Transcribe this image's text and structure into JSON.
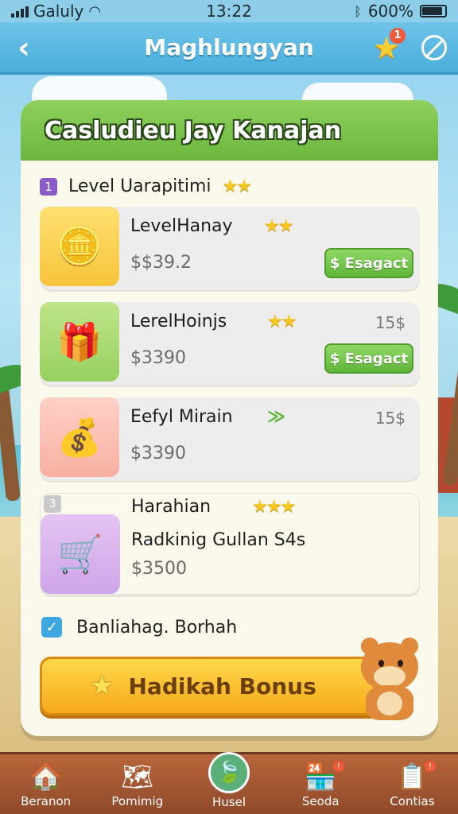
{
  "status_bar": {
    "carrier": "Galuly",
    "time": "13:22",
    "battery": "600%",
    "battery_level": 0.9
  },
  "nav": {
    "title": "Maghlungyan",
    "notification_count": "1"
  },
  "panel": {
    "title": "Casludieu Jay Kanajan",
    "level_badge": "1",
    "level_label": "Level Uarapitimi",
    "level_stars": "★★"
  },
  "items": [
    {
      "name": "LevelHanay",
      "stars": "★★",
      "price": "$$39.2",
      "cost": "",
      "button": "$ Esagact",
      "icon": "coin-barrel-icon"
    },
    {
      "name": "LerelHoinjs",
      "stars": "★★",
      "price": "$3390",
      "cost": "15$",
      "button": "$ Esagact",
      "icon": "gift-box-icon"
    },
    {
      "name": "Eefyl Mirain",
      "stars": "",
      "price": "$3390",
      "cost": "15$",
      "button": "",
      "icon": "coin-pile-icon"
    },
    {
      "name": "Harahian",
      "stars": "★★★",
      "subtitle": "Radkinig Gullan S4s",
      "price": "$3500",
      "badge": "3",
      "icon": "treasure-cart-icon"
    }
  ],
  "checkbox": {
    "label": "Banliahag. Borhah",
    "checked": true
  },
  "bonus_button": {
    "label": "Hadikah Bonus"
  },
  "bottom_tabs": [
    {
      "label": "Beranon",
      "icon": "home-icon"
    },
    {
      "label": "Pomimig",
      "icon": "map-icon"
    },
    {
      "label": "Husel",
      "icon": "leaf-icon"
    },
    {
      "label": "Seoda",
      "icon": "shop-icon"
    },
    {
      "label": "Contias",
      "icon": "contacts-icon"
    }
  ],
  "colors": {
    "nav_blue": "#4aaedc",
    "panel_green": "#6cb63e",
    "buy_green": "#5fb53a",
    "bonus_orange": "#f6a91a",
    "bottom_brown": "#8f4a2a"
  }
}
